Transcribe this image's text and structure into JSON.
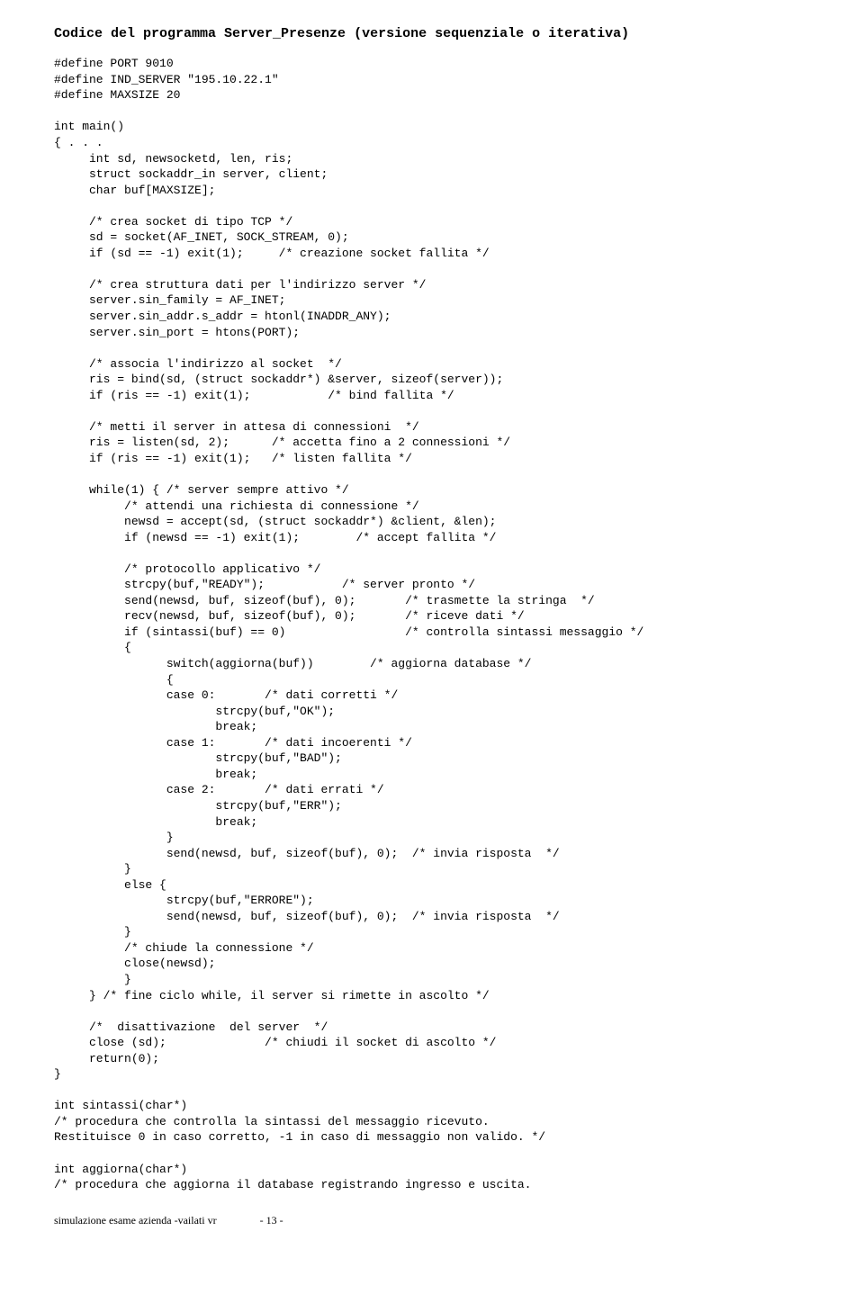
{
  "title_parts": {
    "prefix": "Codice del programma ",
    "program_name": "Server_Presenze",
    "suffix": " (versione sequenziale o iterativa)"
  },
  "code": "#define PORT 9010\n#define IND_SERVER \"195.10.22.1\"\n#define MAXSIZE 20\n\nint main()\n{ . . .\n     int sd, newsocketd, len, ris;\n     struct sockaddr_in server, client;\n     char buf[MAXSIZE];\n\n     /* crea socket di tipo TCP */\n     sd = socket(AF_INET, SOCK_STREAM, 0);\n     if (sd == -1) exit(1);     /* creazione socket fallita */\n\n     /* crea struttura dati per l'indirizzo server */\n     server.sin_family = AF_INET;\n     server.sin_addr.s_addr = htonl(INADDR_ANY);\n     server.sin_port = htons(PORT);\n\n     /* associa l'indirizzo al socket  */\n     ris = bind(sd, (struct sockaddr*) &server, sizeof(server));\n     if (ris == -1) exit(1);           /* bind fallita */\n\n     /* metti il server in attesa di connessioni  */\n     ris = listen(sd, 2);      /* accetta fino a 2 connessioni */\n     if (ris == -1) exit(1);   /* listen fallita */\n\n     while(1) { /* server sempre attivo */\n          /* attendi una richiesta di connessione */\n          newsd = accept(sd, (struct sockaddr*) &client, &len);\n          if (newsd == -1) exit(1);        /* accept fallita */\n\n          /* protocollo applicativo */\n          strcpy(buf,\"READY\");           /* server pronto */\n          send(newsd, buf, sizeof(buf), 0);       /* trasmette la stringa  */\n          recv(newsd, buf, sizeof(buf), 0);       /* riceve dati */\n          if (sintassi(buf) == 0)                 /* controlla sintassi messaggio */\n          {\n                switch(aggiorna(buf))        /* aggiorna database */\n                {\n                case 0:       /* dati corretti */\n                       strcpy(buf,\"OK\");\n                       break;\n                case 1:       /* dati incoerenti */\n                       strcpy(buf,\"BAD\");\n                       break;\n                case 2:       /* dati errati */\n                       strcpy(buf,\"ERR\");\n                       break;\n                }\n                send(newsd, buf, sizeof(buf), 0);  /* invia risposta  */\n          }\n          else {\n                strcpy(buf,\"ERRORE\");\n                send(newsd, buf, sizeof(buf), 0);  /* invia risposta  */\n          }\n          /* chiude la connessione */\n          close(newsd);\n          }\n     } /* fine ciclo while, il server si rimette in ascolto */\n\n     /*  disattivazione  del server  */\n     close (sd);              /* chiudi il socket di ascolto */\n     return(0);\n}\n\nint sintassi(char*)\n/* procedura che controlla la sintassi del messaggio ricevuto.\nRestituisce 0 in caso corretto, -1 in caso di messaggio non valido. */\n\nint aggiorna(char*)\n/* procedura che aggiorna il database registrando ingresso e uscita.",
  "footer": "simulazione esame azienda -vailati vr                - 13 -"
}
